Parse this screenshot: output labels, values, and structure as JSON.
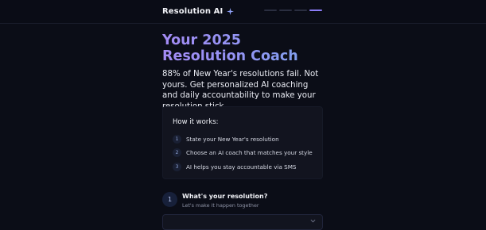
{
  "header": {
    "brand_name": "Resolution AI",
    "brand_icon": "sparkle-icon",
    "progress": {
      "total_steps": 4,
      "current_step": 4
    }
  },
  "hero": {
    "title": "Your 2025 Resolution Coach",
    "subtitle": "88% of New Year's resolutions fail. Not yours. Get personalized AI coaching and daily accountability to make your resolution stick."
  },
  "how_it_works": {
    "title": "How it works:",
    "steps": [
      {
        "number": "1",
        "text": "State your New Year's resolution"
      },
      {
        "number": "2",
        "text": "Choose an AI coach that matches your style"
      },
      {
        "number": "3",
        "text": "AI helps you stay accountable via SMS"
      }
    ]
  },
  "question": {
    "number": "1",
    "title": "What's your resolution?",
    "subtitle": "Let's make it happen together"
  },
  "colors": {
    "background": "#0b0d17",
    "card": "#12141f",
    "accent": "#8b7cf6",
    "title_gradient_start": "#a48bf5",
    "title_gradient_end": "#7aa6ee"
  }
}
